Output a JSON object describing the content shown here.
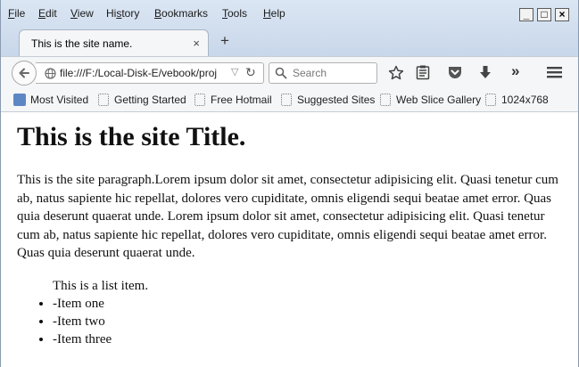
{
  "menu": [
    "File",
    "Edit",
    "View",
    "History",
    "Bookmarks",
    "Tools",
    "Help"
  ],
  "menu_access_keys": [
    "F",
    "E",
    "V",
    "s",
    "B",
    "T",
    "H"
  ],
  "window_controls": {
    "minimize": "_",
    "maximize": "□",
    "close": "×"
  },
  "tab": {
    "title": "This is the site name.",
    "close": "×",
    "new_tab": "+"
  },
  "url": "file:///F:/Local-Disk-E/vebook/proj",
  "search_placeholder": "Search",
  "toolbar_icons": [
    "back-icon",
    "globe-icon",
    "dropdown-icon",
    "reload-icon",
    "search-icon",
    "bookmark-star-icon",
    "reading-list-icon",
    "pocket-icon",
    "downloads-icon",
    "overflow-chevron-icon",
    "hamburger-menu-icon"
  ],
  "bookmarks": [
    {
      "label": "Most Visited",
      "icon": "most-visited-icon"
    },
    {
      "label": "Getting Started",
      "icon": "page-icon"
    },
    {
      "label": "Free Hotmail",
      "icon": "page-icon"
    },
    {
      "label": "Suggested Sites",
      "icon": "page-icon"
    },
    {
      "label": "Web Slice Gallery",
      "icon": "page-icon"
    },
    {
      "label": "1024x768",
      "icon": "page-icon"
    }
  ],
  "page": {
    "title": "This is the site Title.",
    "paragraph": "This is the site paragraph.Lorem ipsum dolor sit amet, consectetur adipisicing elit. Quasi tenetur cum ab, natus sapiente hic repellat, dolores vero cupiditate, omnis eligendi sequi beatae amet error. Quas quia deserunt quaerat unde. Lorem ipsum dolor sit amet, consectetur adipisicing elit. Quasi tenetur cum ab, natus sapiente hic repellat, dolores vero cupiditate, omnis eligendi sequi beatae amet error. Quas quia deserunt quaerat unde.",
    "list_heading": "This is a list item.",
    "list_items": [
      "-Item one",
      "-Item two",
      "-Item three"
    ]
  },
  "colors": {
    "chrome_bg": "#c8d7ea",
    "toolbar_bg": "#f5f6f7",
    "page_bg": "#ffffff",
    "text": "#111111"
  }
}
